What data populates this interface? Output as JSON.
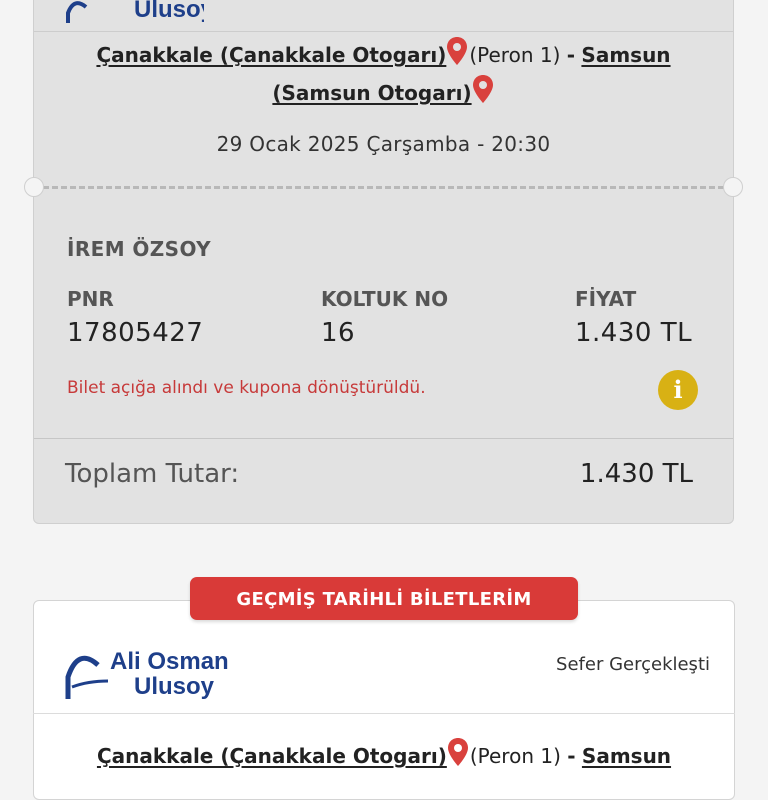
{
  "ticket_current": {
    "logo_text_line2": "Ulusoy",
    "route": {
      "origin": "Çanakkale (Çanakkale Otogarı)",
      "platform": "(Peron 1)",
      "separator": "-",
      "destination_city": "Samsun",
      "destination_terminal": "(Samsun Otogarı)"
    },
    "datetime": "29 Ocak 2025 Çarşamba - 20:30",
    "passenger_name": "İREM ÖZSOY",
    "pnr_label": "PNR",
    "pnr_value": "17805427",
    "seat_label": "KOLTUK NO",
    "seat_value": "16",
    "price_label": "FİYAT",
    "price_value": "1.430 TL",
    "status_note": "Bilet açığa alındı ve kupona dönüştürüldü.",
    "info_icon_glyph": "i",
    "total_label": "Toplam Tutar:",
    "total_value": "1.430 TL"
  },
  "past_tickets": {
    "section_title": "GEÇMİŞ TARİHLİ BİLETLERİM",
    "logo_line1": "Ali Osman",
    "logo_line2": "Ulusoy",
    "status": "Sefer Gerçekleşti",
    "route": {
      "origin": "Çanakkale (Çanakkale Otogarı)",
      "platform": "(Peron 1)",
      "separator": "-",
      "destination_city": "Samsun"
    }
  },
  "colors": {
    "accent_red": "#d93a38",
    "pin_red": "#d9413d",
    "note_red": "#c73a3a",
    "info_yellow": "#d8b114",
    "brand_blue": "#1e3f8a"
  },
  "icons": {
    "pin": "map-pin-icon",
    "info": "info-icon"
  }
}
